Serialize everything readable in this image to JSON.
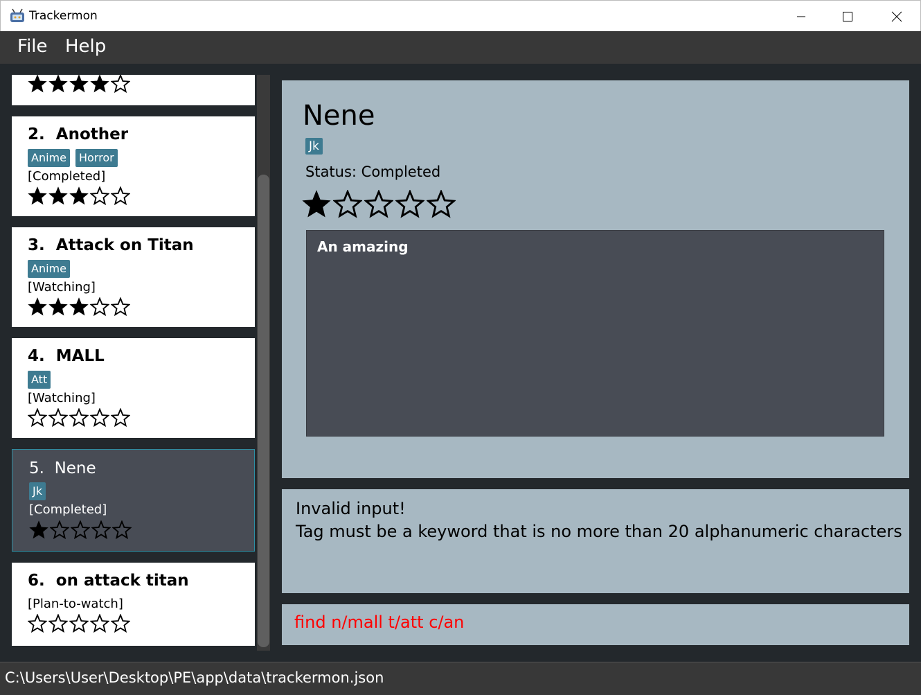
{
  "window": {
    "title": "Trackermon",
    "controls": {
      "minimize": "minimize",
      "maximize": "maximize",
      "close": "close"
    }
  },
  "menu": {
    "file": "File",
    "help": "Help"
  },
  "shows": [
    {
      "index": "",
      "name": "",
      "tags": [],
      "status": "",
      "rating": 4
    },
    {
      "index": "2.",
      "name": "Another",
      "tags": [
        "Anime",
        "Horror"
      ],
      "status": "[Completed]",
      "rating": 3
    },
    {
      "index": "3.",
      "name": "Attack on Titan",
      "tags": [
        "Anime"
      ],
      "status": "[Watching]",
      "rating": 3
    },
    {
      "index": "4.",
      "name": "MALL",
      "tags": [
        "Att"
      ],
      "status": "[Watching]",
      "rating": 0
    },
    {
      "index": "5.",
      "name": "Nene",
      "tags": [
        "Jk"
      ],
      "status": "[Completed]",
      "rating": 1,
      "selected": true
    },
    {
      "index": "6.",
      "name": "on attack titan",
      "tags": [],
      "status": "[Plan-to-watch]",
      "rating": 0
    }
  ],
  "detail": {
    "name": "Nene",
    "tag": "Jk",
    "status": "Status: Completed",
    "rating": 1,
    "description": "An amazing"
  },
  "result": {
    "line1": "Invalid input!",
    "line2": "Tag must be a keyword that is no more than 20 alphanumeric characters"
  },
  "command": {
    "value": "find n/mall t/att c/an"
  },
  "statusbar": {
    "path": "C:\\Users\\User\\Desktop\\PE\\app\\data\\trackermon.json"
  },
  "colors": {
    "tag": "#3e7b91",
    "panel": "#a7b8c2",
    "background": "#23282c",
    "selected_card": "#484c55",
    "error_text": "#ff0000"
  }
}
